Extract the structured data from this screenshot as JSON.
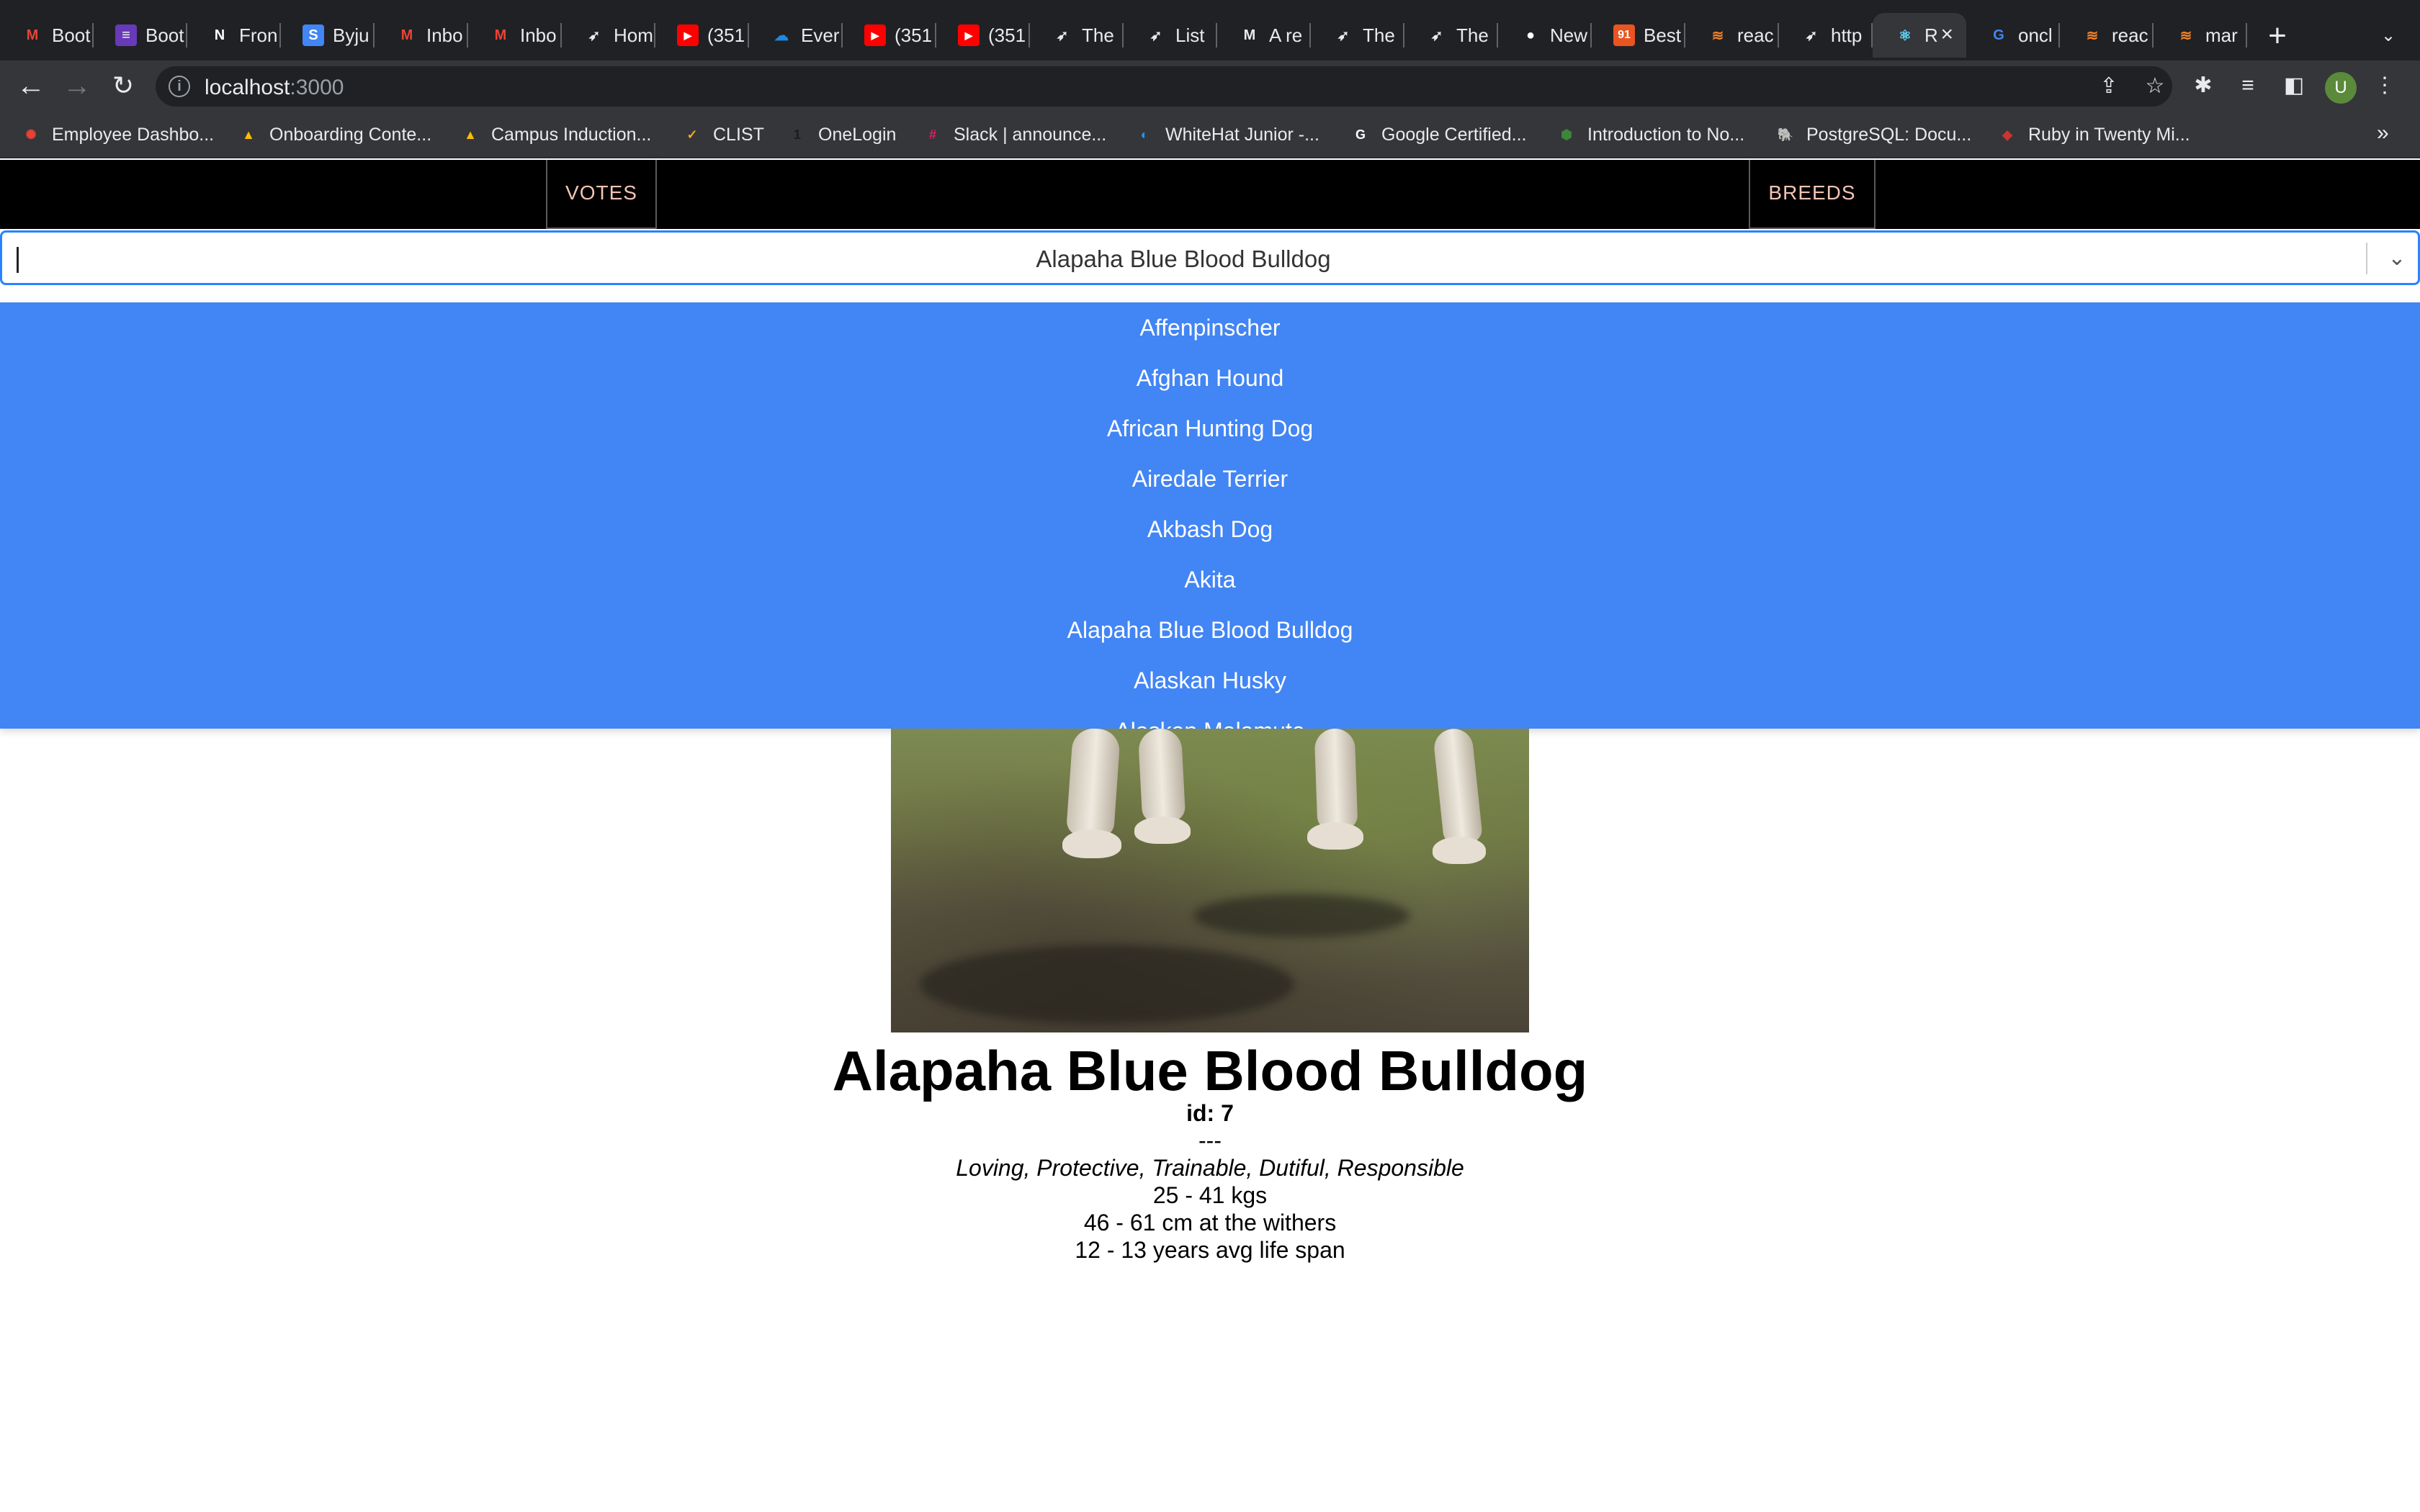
{
  "browser": {
    "tabs": [
      {
        "label": "Boot",
        "icon": "gmail-icon",
        "color": "#ea4335"
      },
      {
        "label": "Boot",
        "icon": "forms-icon",
        "color": "#673ab7"
      },
      {
        "label": "Fron",
        "icon": "notion-icon",
        "color": "#ffffff"
      },
      {
        "label": "Byju",
        "icon": "sites-icon",
        "color": "#4285f4"
      },
      {
        "label": "Inbo",
        "icon": "gmail-icon",
        "color": "#ea4335"
      },
      {
        "label": "Inbo",
        "icon": "gmail-icon",
        "color": "#ea4335"
      },
      {
        "label": "Hom",
        "icon": "cat-icon",
        "color": "#000000"
      },
      {
        "label": "(351",
        "icon": "youtube-icon",
        "color": "#ff0000"
      },
      {
        "label": "Ever",
        "icon": "cloud-icon",
        "color": "#1e88e5"
      },
      {
        "label": "(351",
        "icon": "youtube-icon",
        "color": "#ff0000"
      },
      {
        "label": "(351",
        "icon": "youtube-icon",
        "color": "#ff0000"
      },
      {
        "label": "The",
        "icon": "cat-icon",
        "color": "#000000"
      },
      {
        "label": "List",
        "icon": "cat-icon",
        "color": "#000000"
      },
      {
        "label": "A re",
        "icon": "medium-icon",
        "color": "#000000"
      },
      {
        "label": "The",
        "icon": "cat-icon",
        "color": "#000000"
      },
      {
        "label": "The",
        "icon": "cat-icon",
        "color": "#000000"
      },
      {
        "label": "New",
        "icon": "github-icon",
        "color": "#ffffff"
      },
      {
        "label": "Best",
        "icon": "ninety-one-icon",
        "color": "#e95420"
      },
      {
        "label": "reac",
        "icon": "stackoverflow-icon",
        "color": "#f48024"
      },
      {
        "label": "http",
        "icon": "cat-icon",
        "color": "#000000"
      },
      {
        "label": "R",
        "icon": "react-icon",
        "color": "#61dafb",
        "active": true
      },
      {
        "label": "oncl",
        "icon": "google-icon",
        "color": "#4285f4"
      },
      {
        "label": "reac",
        "icon": "stackoverflow-icon",
        "color": "#f48024"
      },
      {
        "label": "mar",
        "icon": "stackoverflow-icon",
        "color": "#f48024"
      }
    ],
    "url_host": "localhost",
    "url_port": ":3000",
    "bookmarks": [
      {
        "label": "Employee Dashbo...",
        "icon": "pinwheel-icon",
        "color": "#e94235"
      },
      {
        "label": "Onboarding Conte...",
        "icon": "drive-icon",
        "color": "#fbbc04"
      },
      {
        "label": "Campus Induction...",
        "icon": "drive-icon",
        "color": "#fbbc04"
      },
      {
        "label": "CLIST",
        "icon": "clist-icon",
        "color": "#f9a825"
      },
      {
        "label": "OneLogin",
        "icon": "onelogin-icon",
        "color": "#1c1c1c"
      },
      {
        "label": "Slack | announce...",
        "icon": "slack-icon",
        "color": "#e01e5a"
      },
      {
        "label": "WhiteHat Junior -...",
        "icon": "whitehat-icon",
        "color": "#2196f3"
      },
      {
        "label": "Google Certified...",
        "icon": "google-icon",
        "color": "#ffffff"
      },
      {
        "label": "Introduction to No...",
        "icon": "nodejs-icon",
        "color": "#3c873a"
      },
      {
        "label": "PostgreSQL: Docu...",
        "icon": "postgresql-icon",
        "color": "#336791"
      },
      {
        "label": "Ruby in Twenty Mi...",
        "icon": "ruby-icon",
        "color": "#cc342d"
      }
    ]
  },
  "app": {
    "nav": {
      "votes": "VOTES",
      "breeds": "BREEDS"
    },
    "select": {
      "value": "Alapaha Blue Blood Bulldog"
    },
    "options": [
      "Affenpinscher",
      "Afghan Hound",
      "African Hunting Dog",
      "Airedale Terrier",
      "Akbash Dog",
      "Akita",
      "Alapaha Blue Blood Bulldog",
      "Alaskan Husky",
      "Alaskan Malamute"
    ],
    "breed": {
      "name": "Alapaha Blue Blood Bulldog",
      "id": "id: 7",
      "separator": "---",
      "temperament": "Loving, Protective, Trainable, Dutiful, Responsible",
      "weight": "25 - 41 kgs",
      "height": "46 - 61 cm at the withers",
      "life_span": "12 - 13 years avg life span"
    }
  }
}
